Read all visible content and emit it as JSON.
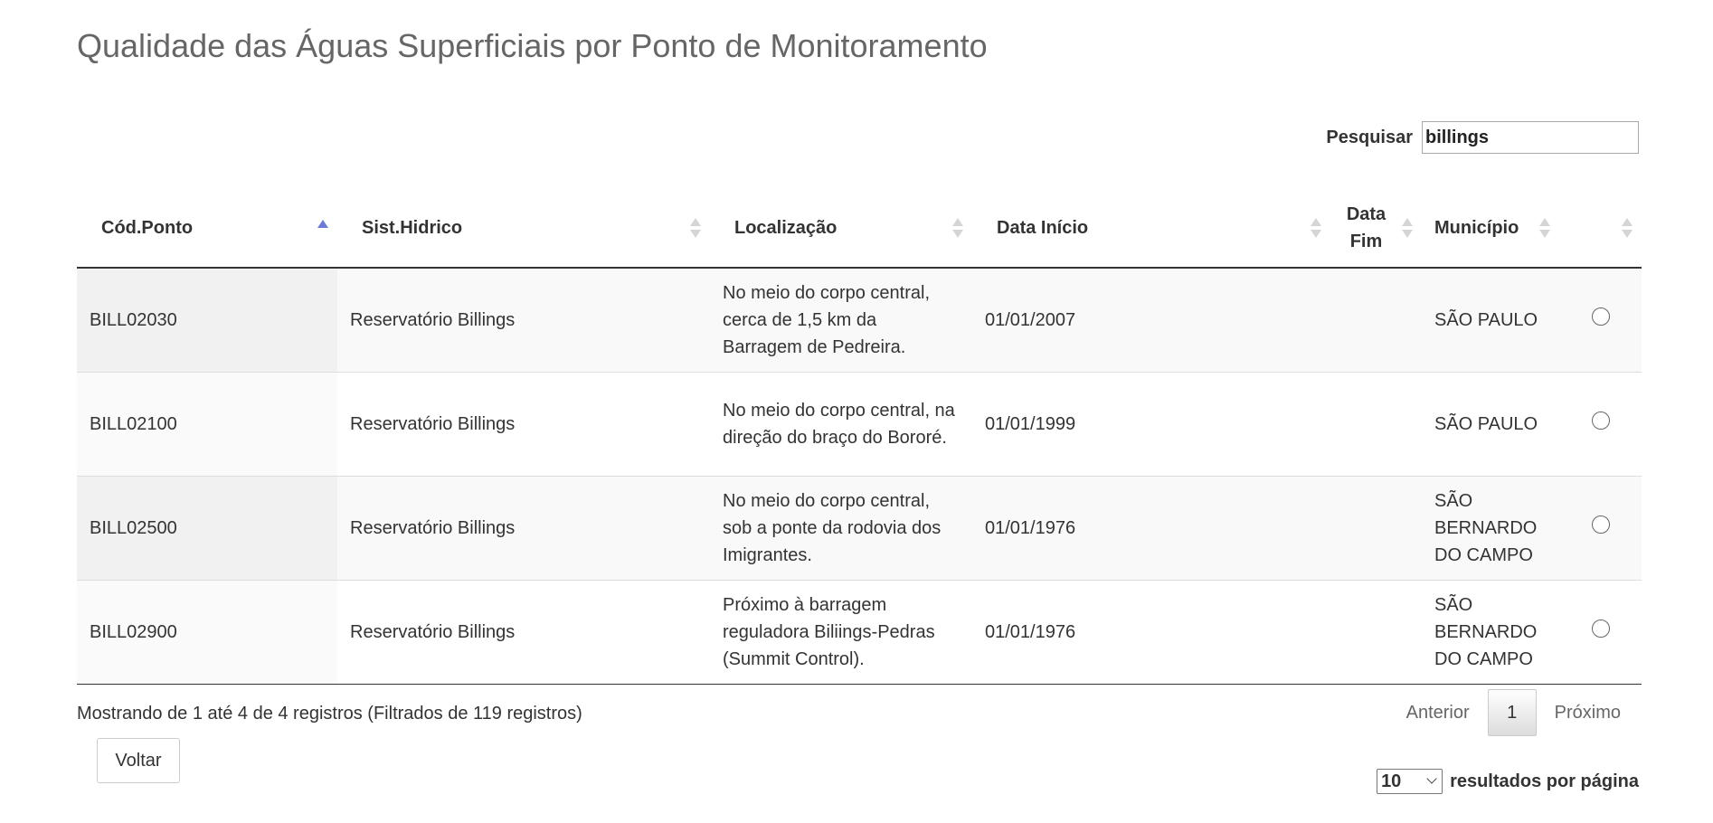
{
  "page": {
    "title": "Qualidade das Águas Superficiais por Ponto de Monitoramento"
  },
  "search": {
    "label": "Pesquisar",
    "value": "billings"
  },
  "table": {
    "columns": [
      {
        "label": "Cód.Ponto",
        "sort": "asc"
      },
      {
        "label": "Sist.Hidrico",
        "sort": "none"
      },
      {
        "label": "Localização",
        "sort": "none"
      },
      {
        "label": "Data Início",
        "sort": "none"
      },
      {
        "label": "Data Fim",
        "sort": "none"
      },
      {
        "label": "Município",
        "sort": "none"
      },
      {
        "label": "",
        "sort": "none"
      }
    ],
    "rows": [
      {
        "code": "BILL02030",
        "system": "Reservatório Billings",
        "location": "No meio do corpo central, cerca de 1,5 km da Barragem de Pedreira.",
        "start": "01/01/2007",
        "end": "",
        "municipality": "SÃO PAULO"
      },
      {
        "code": "BILL02100",
        "system": "Reservatório Billings",
        "location": "No meio do corpo central, na direção do braço do Bororé.",
        "start": "01/01/1999",
        "end": "",
        "municipality": "SÃO PAULO"
      },
      {
        "code": "BILL02500",
        "system": "Reservatório Billings",
        "location": "No meio do corpo central, sob a ponte da rodovia dos Imigrantes.",
        "start": "01/01/1976",
        "end": "",
        "municipality": "SÃO BERNARDO DO CAMPO"
      },
      {
        "code": "BILL02900",
        "system": "Reservatório Billings",
        "location": "Próximo à barragem reguladora Biliings-Pedras (Summit Control).",
        "start": "01/01/1976",
        "end": "",
        "municipality": "SÃO BERNARDO DO CAMPO"
      }
    ]
  },
  "footer": {
    "info": "Mostrando de 1 até 4 de 4 registros (Filtrados de 119 registros)",
    "pager": {
      "prev": "Anterior",
      "page": "1",
      "next": "Próximo"
    },
    "back_label": "Voltar",
    "length": {
      "value": "10",
      "label": "resultados por página"
    }
  }
}
